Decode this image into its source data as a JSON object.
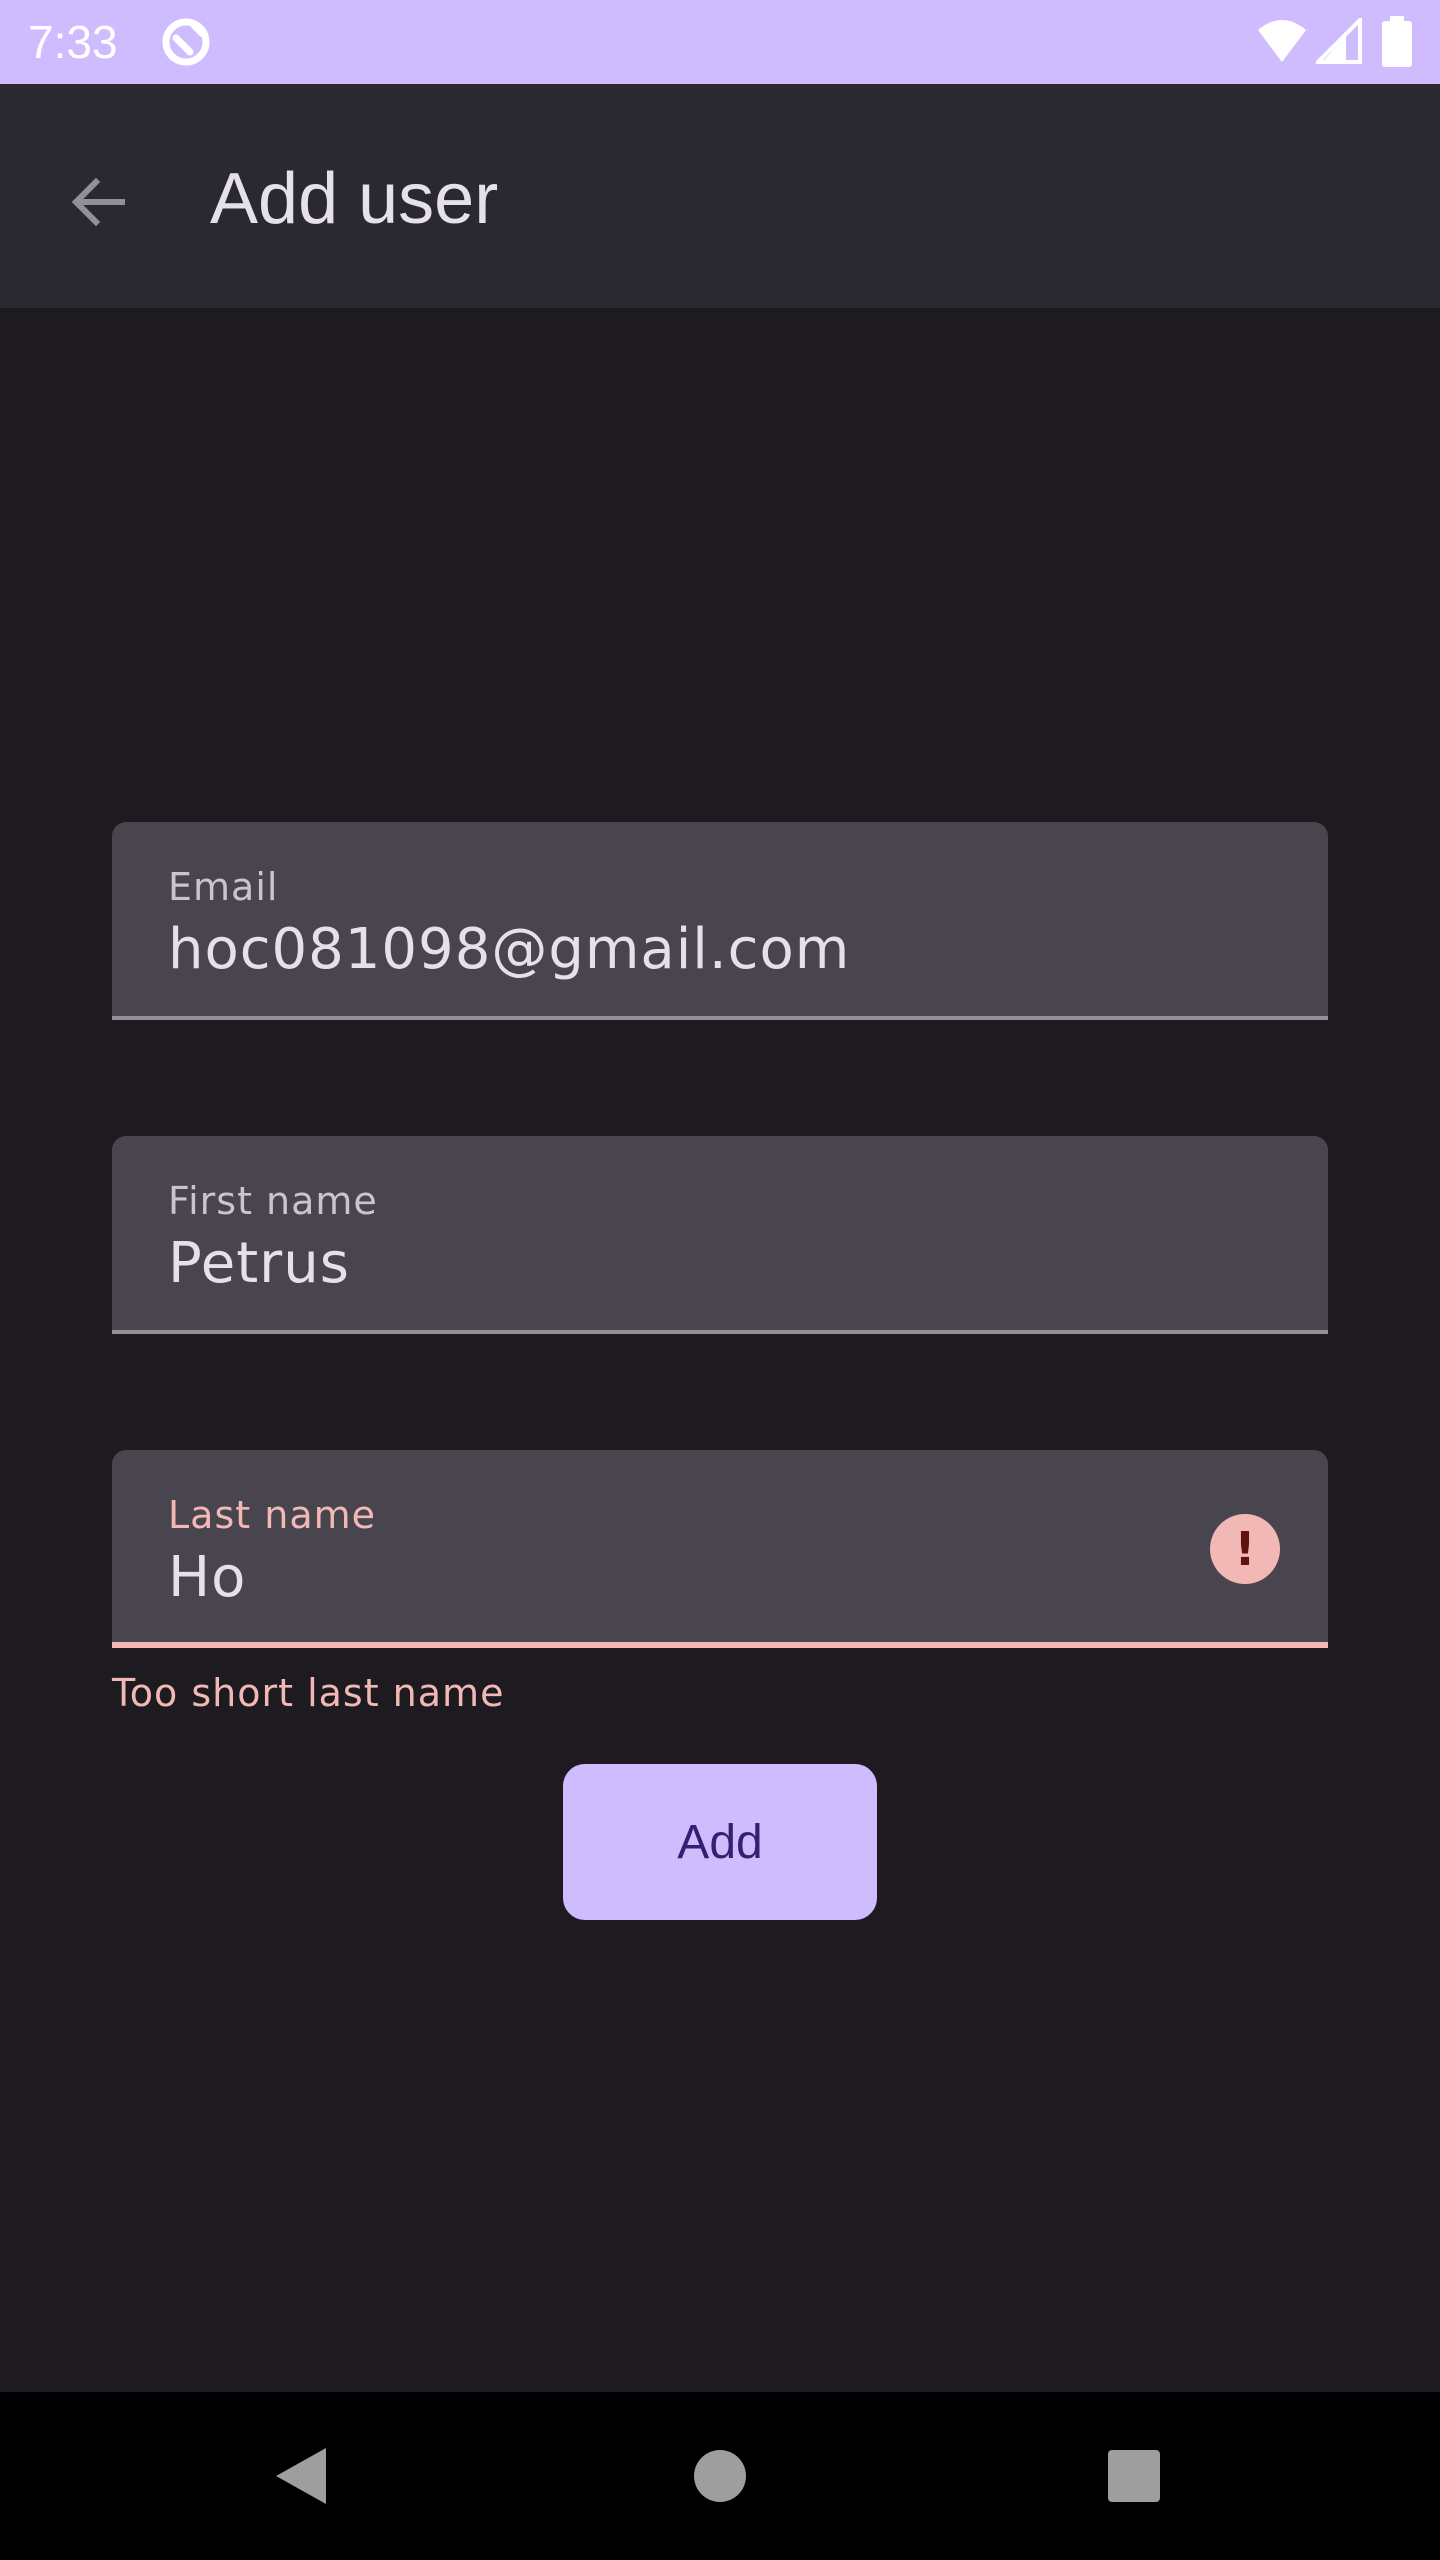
{
  "status_bar": {
    "time": "7:33",
    "icons": [
      "app-notification-icon",
      "wifi-icon",
      "cell-signal-icon",
      "battery-icon"
    ]
  },
  "app_bar": {
    "title": "Add user",
    "back_icon": "arrow-back-icon"
  },
  "form": {
    "email": {
      "label": "Email",
      "value": "hoc081098@gmail.com"
    },
    "first_name": {
      "label": "First name",
      "value": "Petrus"
    },
    "last_name": {
      "label": "Last name",
      "value": "Ho",
      "error": true,
      "error_icon": "error-icon",
      "error_text": "Too short last name"
    },
    "submit_label": "Add"
  },
  "nav_bar": {
    "icons": [
      "nav-back-icon",
      "nav-home-icon",
      "nav-recents-icon"
    ]
  },
  "colors": {
    "status_bar": "#cfbcff",
    "app_bar": "#2b2930",
    "background": "#1d1b20",
    "field_fill": "#49454f",
    "error": "#f2b8b5",
    "button": "#cfbcff",
    "button_text": "#381e72"
  }
}
